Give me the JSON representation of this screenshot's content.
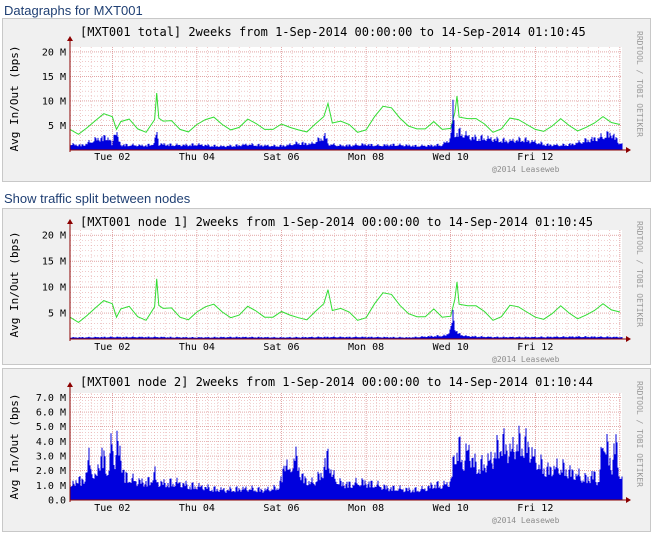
{
  "page": {
    "heading_total": "Datagraphs for MXT001",
    "heading_split": "Show traffic split between nodes"
  },
  "colors": {
    "inbound": "#33dd33",
    "outbound": "#0000dd",
    "grid_minor": "#e6a8a8",
    "grid_major": "#d07070",
    "axis": "#8b0000"
  },
  "chart_data": [
    {
      "type": "area",
      "title": "[MXT001 total] 2weeks from 1-Sep-2014 00:00:00 to 14-Sep-2014 01:10:45",
      "ylabel": "Avg In/Out (bps)",
      "side_label": "RRDTOOL / TOBI OETIKER",
      "watermark": "@2014 Leaseweb",
      "ylim": [
        0,
        21000000
      ],
      "y_ticks": [
        {
          "value": 5000000,
          "label": "5 M"
        },
        {
          "value": 10000000,
          "label": "10 M"
        },
        {
          "value": 15000000,
          "label": "15 M"
        },
        {
          "value": 20000000,
          "label": "20 M"
        }
      ],
      "x_ticks": [
        "Tue 02",
        "Thu 04",
        "Sat 06",
        "Mon 08",
        "Wed 10",
        "Fri 12"
      ],
      "x_days": 13.05,
      "series": [
        {
          "name": "in",
          "style": "line",
          "x": [
            0,
            0.2,
            0.4,
            0.6,
            0.8,
            1.0,
            1.1,
            1.2,
            1.4,
            1.6,
            1.8,
            2.0,
            2.05,
            2.1,
            2.2,
            2.4,
            2.6,
            2.8,
            3.0,
            3.2,
            3.4,
            3.6,
            3.8,
            4.0,
            4.2,
            4.4,
            4.6,
            4.8,
            5.0,
            5.2,
            5.4,
            5.6,
            5.8,
            6.0,
            6.1,
            6.2,
            6.4,
            6.6,
            6.8,
            7.0,
            7.2,
            7.4,
            7.6,
            7.8,
            8.0,
            8.2,
            8.4,
            8.6,
            8.8,
            9.0,
            9.1,
            9.15,
            9.2,
            9.4,
            9.6,
            9.8,
            10.0,
            10.2,
            10.4,
            10.6,
            10.8,
            11.0,
            11.2,
            11.4,
            11.6,
            11.8,
            12.0,
            12.2,
            12.4,
            12.6,
            12.8,
            13.0
          ],
          "values": [
            4200000,
            3200000,
            4500000,
            6000000,
            7400000,
            6800000,
            4200000,
            5800000,
            6300000,
            4300000,
            3600000,
            6200000,
            11600000,
            6500000,
            5900000,
            6000000,
            4200000,
            3700000,
            5200000,
            6200000,
            6700000,
            5200000,
            4100000,
            4600000,
            6300000,
            5400000,
            4200000,
            4200000,
            5300000,
            4600000,
            4100000,
            3700000,
            5300000,
            6800000,
            9500000,
            5500000,
            5900000,
            5200000,
            3600000,
            4100000,
            6800000,
            8900000,
            8600000,
            6500000,
            4900000,
            4300000,
            4300000,
            5800000,
            4200000,
            4400000,
            7700000,
            11000000,
            6700000,
            6400000,
            6400000,
            5300000,
            3600000,
            4300000,
            6500000,
            6200000,
            5200000,
            4200000,
            3800000,
            4900000,
            6400000,
            5000000,
            3900000,
            4600000,
            5500000,
            6800000,
            5600000,
            5200000
          ]
        },
        {
          "name": "out",
          "style": "area",
          "x": [
            0,
            0.3,
            0.6,
            0.9,
            1.0,
            1.05,
            1.2,
            1.5,
            1.8,
            2.0,
            2.05,
            2.1,
            2.4,
            2.7,
            3.0,
            3.3,
            3.6,
            3.9,
            4.2,
            4.5,
            4.8,
            5.1,
            5.4,
            5.7,
            6.0,
            6.05,
            6.1,
            6.4,
            6.7,
            7.0,
            7.3,
            7.6,
            7.9,
            8.2,
            8.5,
            8.8,
            9.0,
            9.05,
            9.1,
            9.2,
            9.5,
            9.8,
            10.1,
            10.4,
            10.7,
            11.0,
            11.3,
            11.6,
            11.9,
            12.2,
            12.5,
            12.8,
            13.0
          ],
          "values": [
            1500000,
            1300000,
            2800000,
            3600000,
            1200000,
            5600000,
            1400000,
            1300000,
            1200000,
            1800000,
            5500000,
            1600000,
            1400000,
            1300000,
            1500000,
            1200000,
            1000000,
            1200000,
            1500000,
            1300000,
            1100000,
            1200000,
            1900000,
            1600000,
            3500000,
            4000000,
            1600000,
            1200000,
            1300000,
            1500000,
            1200000,
            1400000,
            1300000,
            1100000,
            1200000,
            1400000,
            3000000,
            11500000,
            4600000,
            4800000,
            3300000,
            3200000,
            2800000,
            2400000,
            2900000,
            2100000,
            1400000,
            1300000,
            1600000,
            2600000,
            3200000,
            4500000,
            1800000
          ]
        }
      ]
    },
    {
      "type": "area",
      "title": "[MXT001 node 1] 2weeks from 1-Sep-2014 00:00:00 to 14-Sep-2014 01:10:45",
      "ylabel": "Avg In/Out (bps)",
      "side_label": "RRDTOOL / TOBI OETIKER",
      "watermark": "@2014 Leaseweb",
      "ylim": [
        0,
        21000000
      ],
      "y_ticks": [
        {
          "value": 5000000,
          "label": "5 M"
        },
        {
          "value": 10000000,
          "label": "10 M"
        },
        {
          "value": 15000000,
          "label": "15 M"
        },
        {
          "value": 20000000,
          "label": "20 M"
        }
      ],
      "x_ticks": [
        "Tue 02",
        "Thu 04",
        "Sat 06",
        "Mon 08",
        "Wed 10",
        "Fri 12"
      ],
      "x_days": 13.05,
      "series": [
        {
          "name": "in",
          "style": "line",
          "x": [
            0,
            0.2,
            0.4,
            0.6,
            0.8,
            1.0,
            1.1,
            1.2,
            1.4,
            1.6,
            1.8,
            2.0,
            2.05,
            2.1,
            2.2,
            2.4,
            2.6,
            2.8,
            3.0,
            3.2,
            3.4,
            3.6,
            3.8,
            4.0,
            4.2,
            4.4,
            4.6,
            4.8,
            5.0,
            5.2,
            5.4,
            5.6,
            5.8,
            6.0,
            6.1,
            6.2,
            6.4,
            6.6,
            6.8,
            7.0,
            7.2,
            7.4,
            7.6,
            7.8,
            8.0,
            8.2,
            8.4,
            8.6,
            8.8,
            9.0,
            9.1,
            9.15,
            9.2,
            9.4,
            9.6,
            9.8,
            10.0,
            10.2,
            10.4,
            10.6,
            10.8,
            11.0,
            11.2,
            11.4,
            11.6,
            11.8,
            12.0,
            12.2,
            12.4,
            12.6,
            12.8,
            13.0
          ],
          "values": [
            4200000,
            3200000,
            4500000,
            6000000,
            7400000,
            6800000,
            4200000,
            5800000,
            6300000,
            4300000,
            3600000,
            6200000,
            11600000,
            6500000,
            5900000,
            6000000,
            4200000,
            3700000,
            5200000,
            6200000,
            6700000,
            5200000,
            4100000,
            4600000,
            6300000,
            5400000,
            4200000,
            4200000,
            5300000,
            4600000,
            4100000,
            3700000,
            5300000,
            6800000,
            9500000,
            5500000,
            5900000,
            5200000,
            3600000,
            4100000,
            6800000,
            8900000,
            8600000,
            6500000,
            4900000,
            4300000,
            4300000,
            5800000,
            4200000,
            4400000,
            7700000,
            11000000,
            6700000,
            6400000,
            6400000,
            5300000,
            3600000,
            4300000,
            6500000,
            6200000,
            5200000,
            4200000,
            3800000,
            4900000,
            6400000,
            5000000,
            3900000,
            4600000,
            5500000,
            6800000,
            5600000,
            5200000
          ]
        },
        {
          "name": "out",
          "style": "area",
          "x": [
            0,
            1.0,
            2.0,
            3.0,
            4.0,
            5.0,
            6.0,
            7.0,
            8.0,
            8.9,
            9.0,
            9.05,
            9.1,
            9.2,
            9.4,
            10.0,
            11.0,
            12.0,
            13.0
          ],
          "values": [
            400000,
            500000,
            500000,
            400000,
            500000,
            400000,
            500000,
            500000,
            400000,
            900000,
            2500000,
            6200000,
            3000000,
            1200000,
            700000,
            500000,
            500000,
            600000,
            500000
          ]
        }
      ]
    },
    {
      "type": "area",
      "title": "[MXT001 node 2] 2weeks from 1-Sep-2014 00:00:00 to 14-Sep-2014 01:10:44",
      "ylabel": "Avg In/Out (bps)",
      "side_label": "RRDTOOL / TOBI OETIKER",
      "watermark": "@2014 Leaseweb",
      "ylim": [
        0,
        7300000
      ],
      "y_ticks": [
        {
          "value": 0,
          "label": "0.0"
        },
        {
          "value": 1000000,
          "label": "1.0 M"
        },
        {
          "value": 2000000,
          "label": "2.0 M"
        },
        {
          "value": 3000000,
          "label": "3.0 M"
        },
        {
          "value": 4000000,
          "label": "4.0 M"
        },
        {
          "value": 5000000,
          "label": "5.0 M"
        },
        {
          "value": 6000000,
          "label": "6.0 M"
        },
        {
          "value": 7000000,
          "label": "7.0 M"
        }
      ],
      "x_ticks": [
        "Tue 02",
        "Thu 04",
        "Sat 06",
        "Mon 08",
        "Wed 10",
        "Fri 12"
      ],
      "x_days": 13.05,
      "series": [
        {
          "name": "out",
          "style": "area",
          "x": [
            0,
            0.1,
            0.2,
            0.3,
            0.45,
            0.6,
            0.75,
            0.9,
            1.0,
            1.05,
            1.1,
            1.2,
            1.3,
            1.5,
            1.7,
            1.9,
            2.0,
            2.05,
            2.2,
            2.5,
            2.8,
            3.1,
            3.4,
            3.7,
            4.0,
            4.3,
            4.6,
            4.9,
            5.0,
            5.1,
            5.2,
            5.3,
            5.5,
            5.7,
            5.9,
            6.0,
            6.1,
            6.2,
            6.4,
            6.6,
            6.9,
            7.2,
            7.5,
            7.8,
            8.1,
            8.4,
            8.6,
            8.8,
            9.0,
            9.1,
            9.2,
            9.3,
            9.4,
            9.5,
            9.6,
            9.8,
            10.0,
            10.2,
            10.4,
            10.6,
            10.8,
            11.0,
            11.3,
            11.6,
            11.9,
            12.2,
            12.4,
            12.5,
            12.6,
            12.7,
            12.8,
            12.9,
            13.0
          ],
          "values": [
            1500000,
            1300000,
            2100000,
            1500000,
            3600000,
            1800000,
            4300000,
            2500000,
            5500000,
            3000000,
            5300000,
            3900000,
            2100000,
            1800000,
            1600000,
            1700000,
            2500000,
            1600000,
            1500000,
            1600000,
            1300000,
            1200000,
            1000000,
            900000,
            1000000,
            1000000,
            900000,
            1100000,
            1800000,
            3800000,
            2200000,
            4200000,
            2000000,
            1500000,
            2100000,
            2800000,
            4100000,
            2200000,
            1500000,
            1400000,
            1600000,
            1400000,
            1100000,
            1000000,
            900000,
            1000000,
            1400000,
            1300000,
            1600000,
            4300000,
            4800000,
            3200000,
            4600000,
            3800000,
            3100000,
            3200000,
            3800000,
            5400000,
            4300000,
            5200000,
            5100000,
            3600000,
            2700000,
            3000000,
            2400000,
            1900000,
            2300000,
            1500000,
            5500000,
            4800000,
            2800000,
            5400000,
            2100000
          ]
        }
      ]
    }
  ]
}
